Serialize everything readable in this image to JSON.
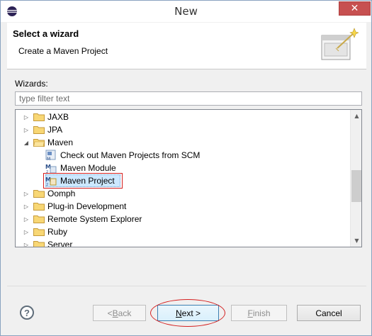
{
  "window": {
    "title": "New",
    "close_label": "✕"
  },
  "header": {
    "title": "Select a wizard",
    "subtitle": "Create a Maven Project"
  },
  "wizards": {
    "label": "Wizards:",
    "filter_placeholder": "type filter text",
    "filter_value": ""
  },
  "tree": {
    "items": [
      {
        "label": "JAXB",
        "kind": "folder",
        "expanded": false,
        "level": 0
      },
      {
        "label": "JPA",
        "kind": "folder",
        "expanded": false,
        "level": 0
      },
      {
        "label": "Maven",
        "kind": "folder",
        "expanded": true,
        "level": 0
      },
      {
        "label": "Check out Maven Projects from SCM",
        "kind": "item",
        "level": 1
      },
      {
        "label": "Maven Module",
        "kind": "item",
        "level": 1
      },
      {
        "label": "Maven Project",
        "kind": "item",
        "level": 1,
        "selected": true
      },
      {
        "label": "Oomph",
        "kind": "folder",
        "expanded": false,
        "level": 0
      },
      {
        "label": "Plug-in Development",
        "kind": "folder",
        "expanded": false,
        "level": 0
      },
      {
        "label": "Remote System Explorer",
        "kind": "folder",
        "expanded": false,
        "level": 0
      },
      {
        "label": "Ruby",
        "kind": "folder",
        "expanded": false,
        "level": 0
      },
      {
        "label": "Server",
        "kind": "folder",
        "expanded": false,
        "level": 0
      }
    ]
  },
  "buttons": {
    "help": "?",
    "back_prefix": "< ",
    "back_mnemonic": "B",
    "back_rest": "ack",
    "next_mnemonic": "N",
    "next_rest": "ext >",
    "finish_mnemonic": "F",
    "finish_rest": "inish",
    "cancel": "Cancel"
  },
  "colors": {
    "selection_highlight": "#cce8ff",
    "annotation_red": "#d41f1f",
    "close_red": "#c75050"
  }
}
